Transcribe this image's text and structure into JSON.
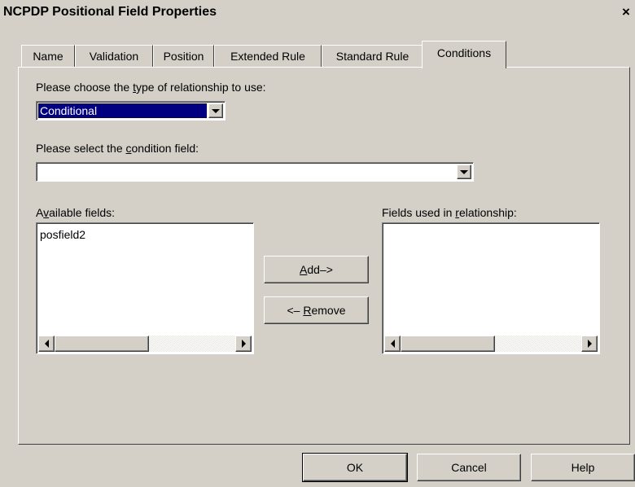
{
  "window": {
    "title": "NCPDP Positional Field Properties",
    "close_glyph": "×"
  },
  "tabs": [
    {
      "label": "Name",
      "active": false
    },
    {
      "label": "Validation",
      "active": false
    },
    {
      "label": "Position",
      "active": false
    },
    {
      "label": "Extended Rule",
      "active": false
    },
    {
      "label": "Standard Rule",
      "active": false
    },
    {
      "label": "Conditions",
      "active": true
    }
  ],
  "conditions": {
    "relationship_label_pre": "Please choose the ",
    "relationship_label_key": "t",
    "relationship_label_post": "ype of relationship to use:",
    "relationship_value": "Conditional",
    "condition_label_pre": "Please select the ",
    "condition_label_key": "c",
    "condition_label_post": "ondition field:",
    "condition_value": "",
    "available_label_pre": "A",
    "available_label_key": "v",
    "available_label_post": "ailable fields:",
    "available_items": [
      "posfield2"
    ],
    "used_label_pre": "Fields used in ",
    "used_label_key": "r",
    "used_label_post": "elationship:",
    "used_items": [],
    "add_button_key": "A",
    "add_button_rest": "dd–>",
    "remove_button_pre": "<– ",
    "remove_button_key": "R",
    "remove_button_rest": "emove"
  },
  "footer": {
    "ok_label": "OK",
    "cancel_label": "Cancel",
    "help_label": "Help"
  },
  "icons": {
    "dropdown": "chevron-down-icon",
    "scroll_left": "arrow-left-icon",
    "scroll_right": "arrow-right-icon",
    "close": "close-icon"
  }
}
